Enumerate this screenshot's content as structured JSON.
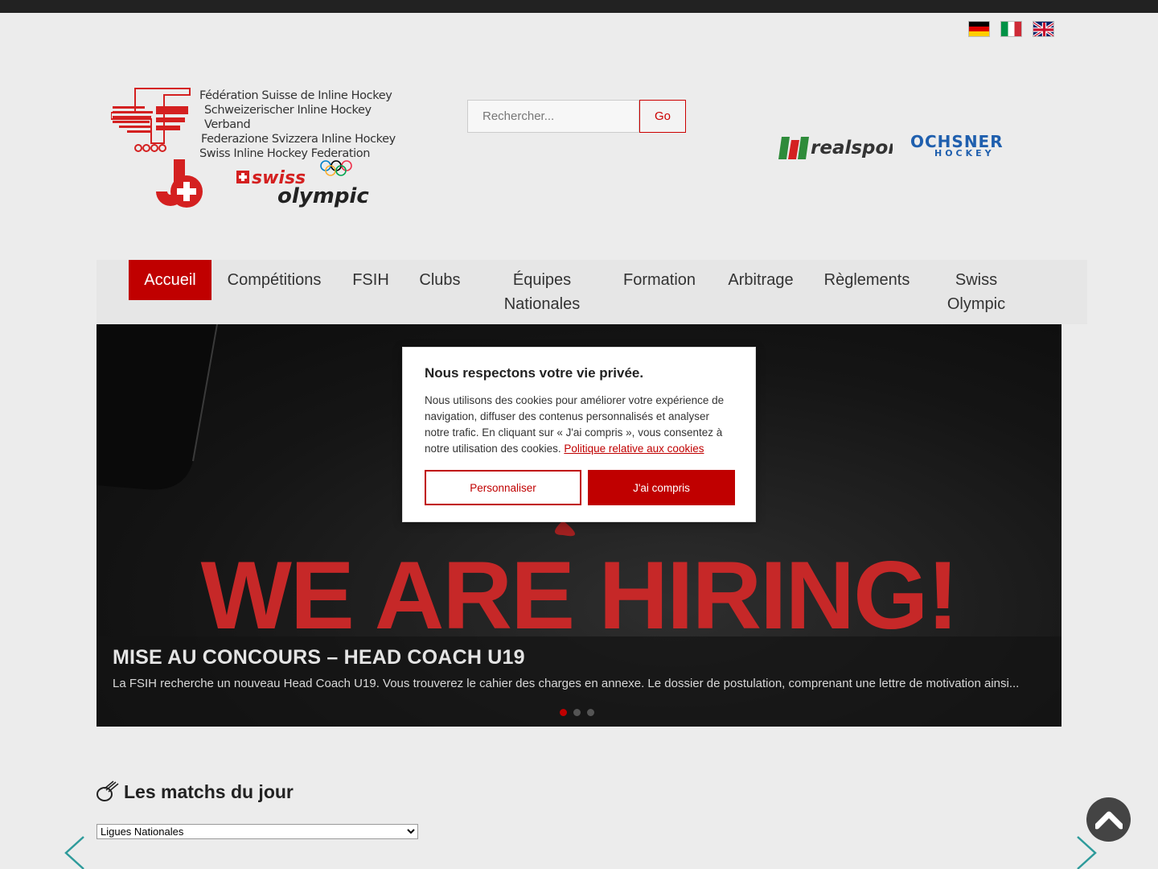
{
  "languages": [
    {
      "name": "Deutsch",
      "code": "de"
    },
    {
      "name": "Italiano",
      "code": "it"
    },
    {
      "name": "English",
      "code": "en"
    }
  ],
  "header": {
    "federation_names": [
      "Fédération Suisse de Inline Hockey",
      "Schweizerischer Inline Hockey Verband",
      "Federazione Svizzera Inline Hockey",
      "Swiss Inline Hockey Federation"
    ],
    "swiss_olympic_logo": "swiss olympic",
    "search": {
      "placeholder": "Rechercher...",
      "button_label": "Go"
    },
    "sponsors": [
      "realsport",
      "OCHSNER HOCKEY"
    ]
  },
  "nav": {
    "items": [
      {
        "label": "Accueil",
        "active": true
      },
      {
        "label": "Compétitions"
      },
      {
        "label": "FSIH"
      },
      {
        "label": "Clubs"
      },
      {
        "label": "Équipes Nationales"
      },
      {
        "label": "Formation"
      },
      {
        "label": "Arbitrage"
      },
      {
        "label": "Règlements"
      },
      {
        "label": "Swiss Olympic"
      }
    ]
  },
  "slider": {
    "image_text": "WE ARE HIRING!",
    "title": "MISE AU CONCOURS – HEAD COACH U19",
    "excerpt": "La FSIH recherche un nouveau Head Coach U19. Vous trouverez le cahier des charges en annexe.   Le dossier de postulation, comprenant une lettre de motivation ainsi...",
    "slide_count": 3,
    "active_slide": 1
  },
  "cookie_banner": {
    "title": "Nous respectons votre vie privée.",
    "text": "Nous utilisons des cookies pour améliorer votre expérience de navigation, diffuser des contenus personnalisés et analyser notre trafic. En cliquant sur « J'ai compris », vous consentez à notre utilisation des cookies. ",
    "link_label": "Politique relative aux cookies",
    "customize_label": "Personnaliser",
    "accept_label": "J'ai compris"
  },
  "matches": {
    "title": "Les matchs du jour",
    "league_options": [
      "Ligues Nationales"
    ]
  },
  "colors": {
    "accent": "#c00000",
    "topbar": "#222222",
    "page_bg": "#ececec"
  }
}
